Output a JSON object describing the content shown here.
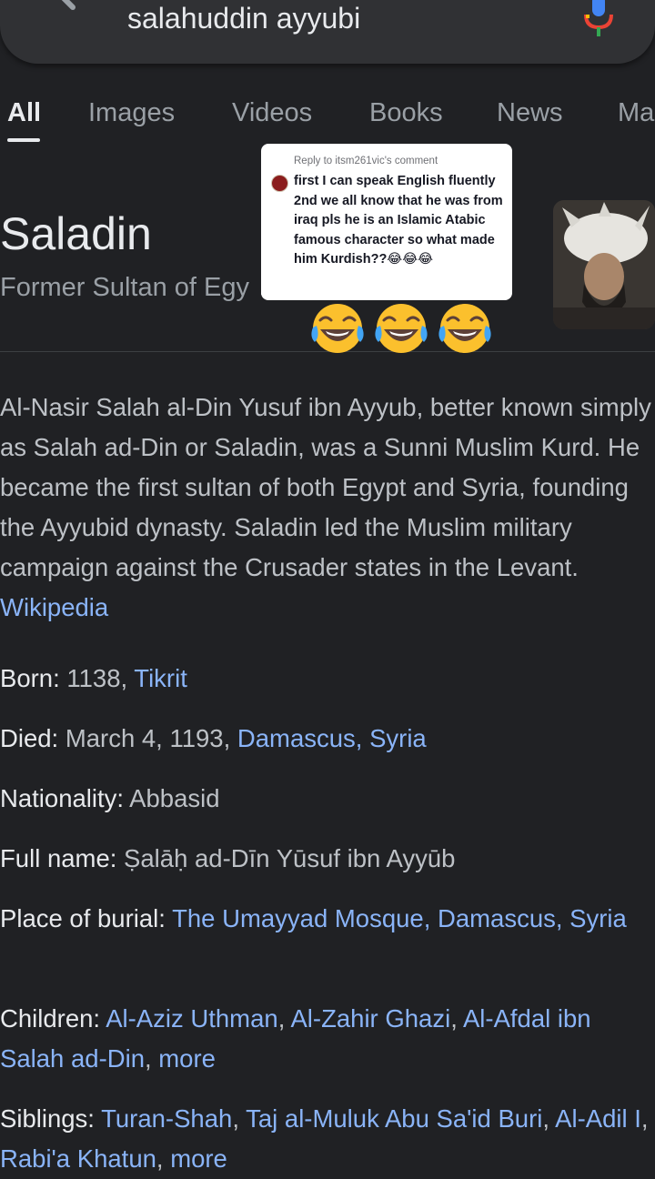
{
  "search": {
    "query": "salahuddin ayyubi"
  },
  "tabs": [
    {
      "label": "All"
    },
    {
      "label": "Images"
    },
    {
      "label": "Videos"
    },
    {
      "label": "Books"
    },
    {
      "label": "News"
    },
    {
      "label": "Ma"
    }
  ],
  "entity": {
    "title": "Saladin",
    "subtitle": "Former Sultan of Egy"
  },
  "description": {
    "text": "Al-Nasir Salah al-Din Yusuf ibn Ayyub, better known simply as Salah ad-Din or Saladin, was a Sunni Muslim Kurd. He became the first sultan of both Egypt and Syria, founding the Ayyubid dynasty. Saladin led the Muslim military campaign against the Crusader states in the Levant. ",
    "source_link": "Wikipedia"
  },
  "facts": {
    "born": {
      "label": "Born:",
      "value": " 1138, ",
      "link": "Tikrit"
    },
    "died": {
      "label": "Died:",
      "value": " March 4, 1193, ",
      "link": "Damascus, Syria"
    },
    "nationality": {
      "label": "Nationality:",
      "value": " Abbasid"
    },
    "full_name": {
      "label": "Full name:",
      "value": " Ṣalāḥ ad-Dīn Yūsuf ibn Ayyūb"
    },
    "burial": {
      "label": "Place of burial:",
      "link": "The Umayyad Mosque, Damascus, Syria"
    },
    "children": {
      "label": "Children:",
      "links": [
        "Al-Aziz Uthman",
        "Al-Zahir Ghazi",
        "Al-Afdal ibn Salah ad-Din"
      ],
      "more": "more"
    },
    "siblings": {
      "label": "Siblings:",
      "links": [
        "Turan-Shah",
        "Taj al-Muluk Abu Sa'id Buri",
        "Al-Adil I",
        "Rabi'a Khatun"
      ],
      "more": "more"
    }
  },
  "overlay": {
    "reply_header": "Reply to itsm261vic's comment",
    "comment": "first I can speak English fluently 2nd we all know that he was from iraq pls he is an Islamic Atabic famous character so what made him Kurdish??😂😂😂",
    "reaction_emojis": [
      "😂",
      "😂",
      "😂"
    ]
  },
  "colors": {
    "background": "#202124",
    "link": "#8ab4f8",
    "text_secondary": "#bdc1c6",
    "text_primary": "#e8eaed"
  }
}
